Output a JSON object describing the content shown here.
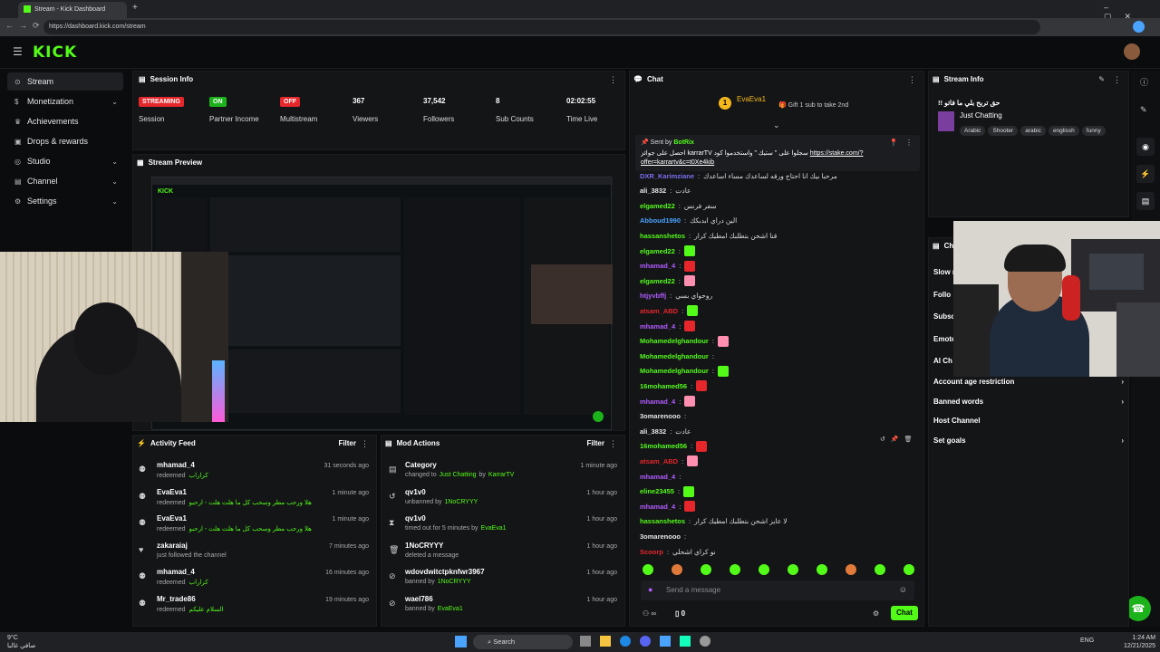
{
  "browser": {
    "tab_title": "Stream - Kick Dashboard",
    "url": "https://dashboard.kick.com/stream"
  },
  "header": {
    "logo": "KICK"
  },
  "sidebar": {
    "items": [
      {
        "label": "Stream",
        "icon": "stream-icon",
        "active": true
      },
      {
        "label": "Monetization",
        "icon": "dollar-icon",
        "chevron": true
      },
      {
        "label": "Achievements",
        "icon": "trophy-icon"
      },
      {
        "label": "Drops & rewards",
        "icon": "gift-icon"
      },
      {
        "label": "Studio",
        "icon": "studio-icon",
        "chevron": true
      },
      {
        "label": "Channel",
        "icon": "channel-icon",
        "chevron": true
      },
      {
        "label": "Settings",
        "icon": "gear-icon",
        "chevron": true
      }
    ]
  },
  "session_info": {
    "title": "Session Info",
    "stats": [
      {
        "value": "STREAMING",
        "label": "Session",
        "badge_color": "#e5262b"
      },
      {
        "value": "ON",
        "label": "Partner Income",
        "badge_color": "#1cb21c"
      },
      {
        "value": "OFF",
        "label": "Multistream",
        "badge_color": "#e5262b"
      },
      {
        "value": "367",
        "label": "Viewers"
      },
      {
        "value": "37,542",
        "label": "Followers"
      },
      {
        "value": "8",
        "label": "Sub Counts"
      },
      {
        "value": "02:02:55",
        "label": "Time Live"
      }
    ]
  },
  "stream_preview": {
    "title": "Stream Preview"
  },
  "activity_feed": {
    "title": "Activity Feed",
    "filter": "Filter",
    "items": [
      {
        "name": "mhamad_4",
        "sub": "redeemed",
        "extra": "كراراب",
        "time": "31 seconds ago"
      },
      {
        "name": "EvaEva1",
        "sub": "redeemed",
        "extra": "هلا ورحب مطر وسحب كل ما هلت هلت - ارحبو",
        "time": "1 minute ago"
      },
      {
        "name": "EvaEva1",
        "sub": "redeemed",
        "extra": "هلا ورحب مطر وسحب كل ما هلت هلت - ارحبو",
        "time": "1 minute ago"
      },
      {
        "name": "zakaraiaj",
        "sub": "just followed the channel",
        "extra": "",
        "time": "7 minutes ago"
      },
      {
        "name": "mhamad_4",
        "sub": "redeemed",
        "extra": "كراراب",
        "time": "16 minutes ago"
      },
      {
        "name": "Mr_trade86",
        "sub": "redeemed",
        "extra": "السلام عليكم",
        "time": "19 minutes ago"
      }
    ]
  },
  "mod_actions": {
    "title": "Mod Actions",
    "filter": "Filter",
    "items": [
      {
        "name": "Category",
        "sub": "changed to",
        "target": "Just Chatting",
        "by": "by",
        "actor": "KarrarTV",
        "time": "1 minute ago"
      },
      {
        "name": "qv1v0",
        "sub": "unbanned by",
        "target": "",
        "by": "",
        "actor": "1NoCRYYY",
        "time": "1 hour ago"
      },
      {
        "name": "qv1v0",
        "sub": "timed out for 5 minutes by",
        "target": "",
        "by": "",
        "actor": "EvaEva1",
        "time": "1 hour ago"
      },
      {
        "name": "1NoCRYYY",
        "sub": "deleted a message",
        "target": "",
        "by": "",
        "actor": "",
        "time": "1 hour ago"
      },
      {
        "name": "wdovdwitctpknfwr3967",
        "sub": "banned by",
        "target": "",
        "by": "",
        "actor": "1NoCRYYY",
        "time": "1 hour ago"
      },
      {
        "name": "wael786",
        "sub": "banned by",
        "target": "",
        "by": "",
        "actor": "EvaEva1",
        "time": "1 hour ago"
      }
    ]
  },
  "chat": {
    "title": "Chat",
    "pinned_user": "EvaEva1",
    "pinned_sub": "1",
    "gift_text": "Gift 1 sub to take 2nd",
    "sent_by_label": "Sent by",
    "sent_by_user": "BotRix",
    "pinned_message": "احصل على جوائز karrarTV سجلوا على \" ستيك \" واستخدموا كود",
    "pinned_link": "https://stake.com/?offer=karrartv&c=t0Xe4kib",
    "messages": [
      {
        "user": "DXR_Karimziane",
        "color": "#7b6ff0",
        "text": "مرحبا بيك انا احتاج ورقه لساعدك مساء اساعدك"
      },
      {
        "user": "ali_3832",
        "color": "#e6e6e6",
        "text": "عادت"
      },
      {
        "user": "elgamed22",
        "color": "#53fc18",
        "text": "سفر فرنس"
      },
      {
        "user": "Abboud1990",
        "color": "#4aa3ff",
        "text": "الين دراي ابدبكك"
      },
      {
        "user": "hassanshetos",
        "color": "#53fc18",
        "text": "قنا اشحن بتطلبك امطيك كرار"
      },
      {
        "user": "elgamed22",
        "color": "#53fc18",
        "text": ""
      },
      {
        "user": "mhamad_4",
        "color": "#b15bff",
        "text": ""
      },
      {
        "user": "elgamed22",
        "color": "#53fc18",
        "text": ""
      },
      {
        "user": "htjyvbffj",
        "color": "#b15bff",
        "text": "روحواي بسي"
      },
      {
        "user": "atsam_ABD",
        "color": "#e5262b",
        "text": ""
      },
      {
        "user": "mhamad_4",
        "color": "#b15bff",
        "text": ""
      },
      {
        "user": "Mohamedelghandour",
        "color": "#53fc18",
        "text": ""
      },
      {
        "user": "Mohamedelghandour",
        "color": "#53fc18",
        "text": ""
      },
      {
        "user": "Mohamedelghandour",
        "color": "#53fc18",
        "text": ""
      },
      {
        "user": "16mohamed56",
        "color": "#53fc18",
        "text": ""
      },
      {
        "user": "mhamad_4",
        "color": "#b15bff",
        "text": ""
      },
      {
        "user": "3omarenooo",
        "color": "#e6e6e6",
        "text": ""
      },
      {
        "user": "ali_3832",
        "color": "#e6e6e6",
        "text": "عادت"
      },
      {
        "user": "16mohamed56",
        "color": "#53fc18",
        "text": ""
      },
      {
        "user": "atsam_ABD",
        "color": "#e5262b",
        "text": ""
      },
      {
        "user": "mhamad_4",
        "color": "#b15bff",
        "text": ""
      },
      {
        "user": "eline23455",
        "color": "#53fc18",
        "text": ""
      },
      {
        "user": "mhamad_4",
        "color": "#b15bff",
        "text": ""
      },
      {
        "user": "hassanshetos",
        "color": "#53fc18",
        "text": "لا عايز اشحن بتطلبك امطيك كرار"
      },
      {
        "user": "3omarenooo",
        "color": "#e6e6e6",
        "text": ""
      },
      {
        "user": "Scoorp",
        "color": "#e5262b",
        "text": "نو كراي اشحلي"
      }
    ],
    "input_placeholder": "Send a message",
    "viewer_count": "0",
    "send_label": "Chat"
  },
  "stream_info": {
    "title": "Stream Info",
    "stream_title": "!! حق تربح بلي ما فاتو",
    "category": "Just Chatting",
    "tags": [
      "Arabic",
      "Shooter",
      "arabic",
      "englissh",
      "funny"
    ]
  },
  "chat_settings": {
    "title_partial": "Ch",
    "items_partial": [
      "Slow r",
      "Follo",
      "Subsc",
      "Emote",
      "AI Ch"
    ],
    "items": [
      {
        "label": "Account age restriction",
        "chevron": true
      },
      {
        "label": "Banned words",
        "chevron": true
      },
      {
        "label": "Host Channel",
        "chevron": false
      },
      {
        "label": "Set goals",
        "chevron": true
      }
    ]
  },
  "taskbar": {
    "weather_temp": "9°C",
    "weather_text": "صافي غالبا",
    "search": "Search",
    "lang": "ENG",
    "time": "1:24 AM",
    "date": "12/21/2025"
  },
  "colors": {
    "accent": "#53fc18",
    "bg": "#0b0c0e",
    "panel": "#141517",
    "danger": "#e5262b"
  }
}
